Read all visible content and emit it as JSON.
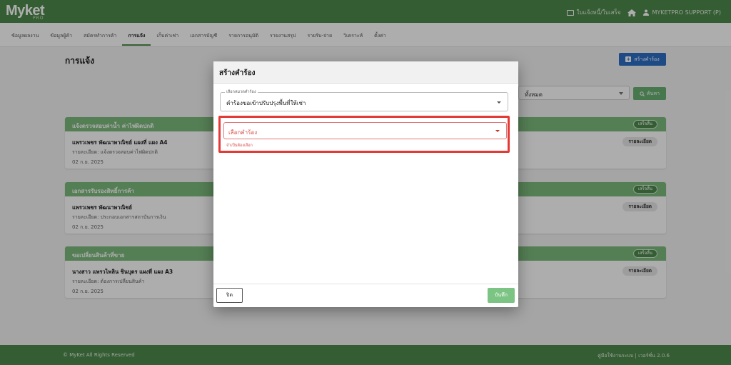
{
  "header": {
    "logo": "Myket",
    "logo_sub": "PRO",
    "invoice_label": "ใบแจ้งหนี้/ใบเสร็จ",
    "user_label": "MYKETPRO SUPPORT (P)"
  },
  "nav": {
    "tabs": [
      {
        "label": "ข้อมูลผลงาน"
      },
      {
        "label": "ข้อมูลผู้ค้า"
      },
      {
        "label": "สมัครทำการค้า"
      },
      {
        "label": "การแจ้ง"
      },
      {
        "label": "เก็บค่าเช่า"
      },
      {
        "label": "เอกสารบัญชี"
      },
      {
        "label": "รายการอนุมัติ"
      },
      {
        "label": "รายงานสรุป"
      },
      {
        "label": "รายรับ-จ่าย"
      },
      {
        "label": "วิเคราะห์"
      },
      {
        "label": "ตั้งค่า"
      }
    ]
  },
  "main": {
    "title": "การแจ้ง",
    "add_button": "สร้างคำร้อง",
    "filter_value": "ทั้งหมด",
    "search_button": "ค้นหา",
    "cards": [
      {
        "title": "แจ้งตรวจสอบค่าน้ำ ค่าไฟผิดปกติ",
        "status": "เสร็จสิ้น",
        "name": "แพรวเพชร พัฒนาพาณิชย์ แผงที่ แผง A4",
        "desc": "รายละเอียด: แจ้งตรวจสอบค่าไฟผิดปกติ",
        "date": "02 ก.ย. 2025",
        "detail": "รายละเอียด"
      },
      {
        "title": "เอกสารรับรองสิทธิ์การค้า",
        "status": "เสร็จสิ้น",
        "name": "แพรวเพชร พัฒนาพาณิชย์",
        "desc": "รายละเอียด: ประกอบเอกสารสถาบันการเงิน",
        "date": "02 ก.ย. 2025",
        "detail": "รายละเอียด"
      },
      {
        "title": "ขอเปลี่ยนสินค้าที่ขาย",
        "status": "เสร็จสิ้น",
        "name": "นางสาว แพรวไพลิน ชินบุตร แผงที่ แผง A3",
        "desc": "รายละเอียด: ต้องการเปลี่ยนสินค้า",
        "date": "02 ก.ย. 2025",
        "detail": "รายละเอียด"
      }
    ]
  },
  "footer": {
    "copyright": "© MyKet All Rights Reserved",
    "version": "คู่มือใช้งานระบบ | เวอร์ชั่น 2.0.6"
  },
  "modal": {
    "title": "สร้างคำร้อง",
    "category_label": "เลือกหมวดคำร้อง",
    "category_value": "คำร้องขอเข้าปรับปรุงพื้นที่ให้เช่า",
    "request_placeholder": "เลือกคำร้อง",
    "error_text": "จำเป็นต้องเลือก",
    "close_button": "ปิด",
    "save_button": "บันทึก"
  },
  "colors": {
    "header_green": "#4f8a4c",
    "card_head_green": "#7dba7c",
    "primary_blue": "#2d6fc4",
    "error_red": "#e53935"
  }
}
